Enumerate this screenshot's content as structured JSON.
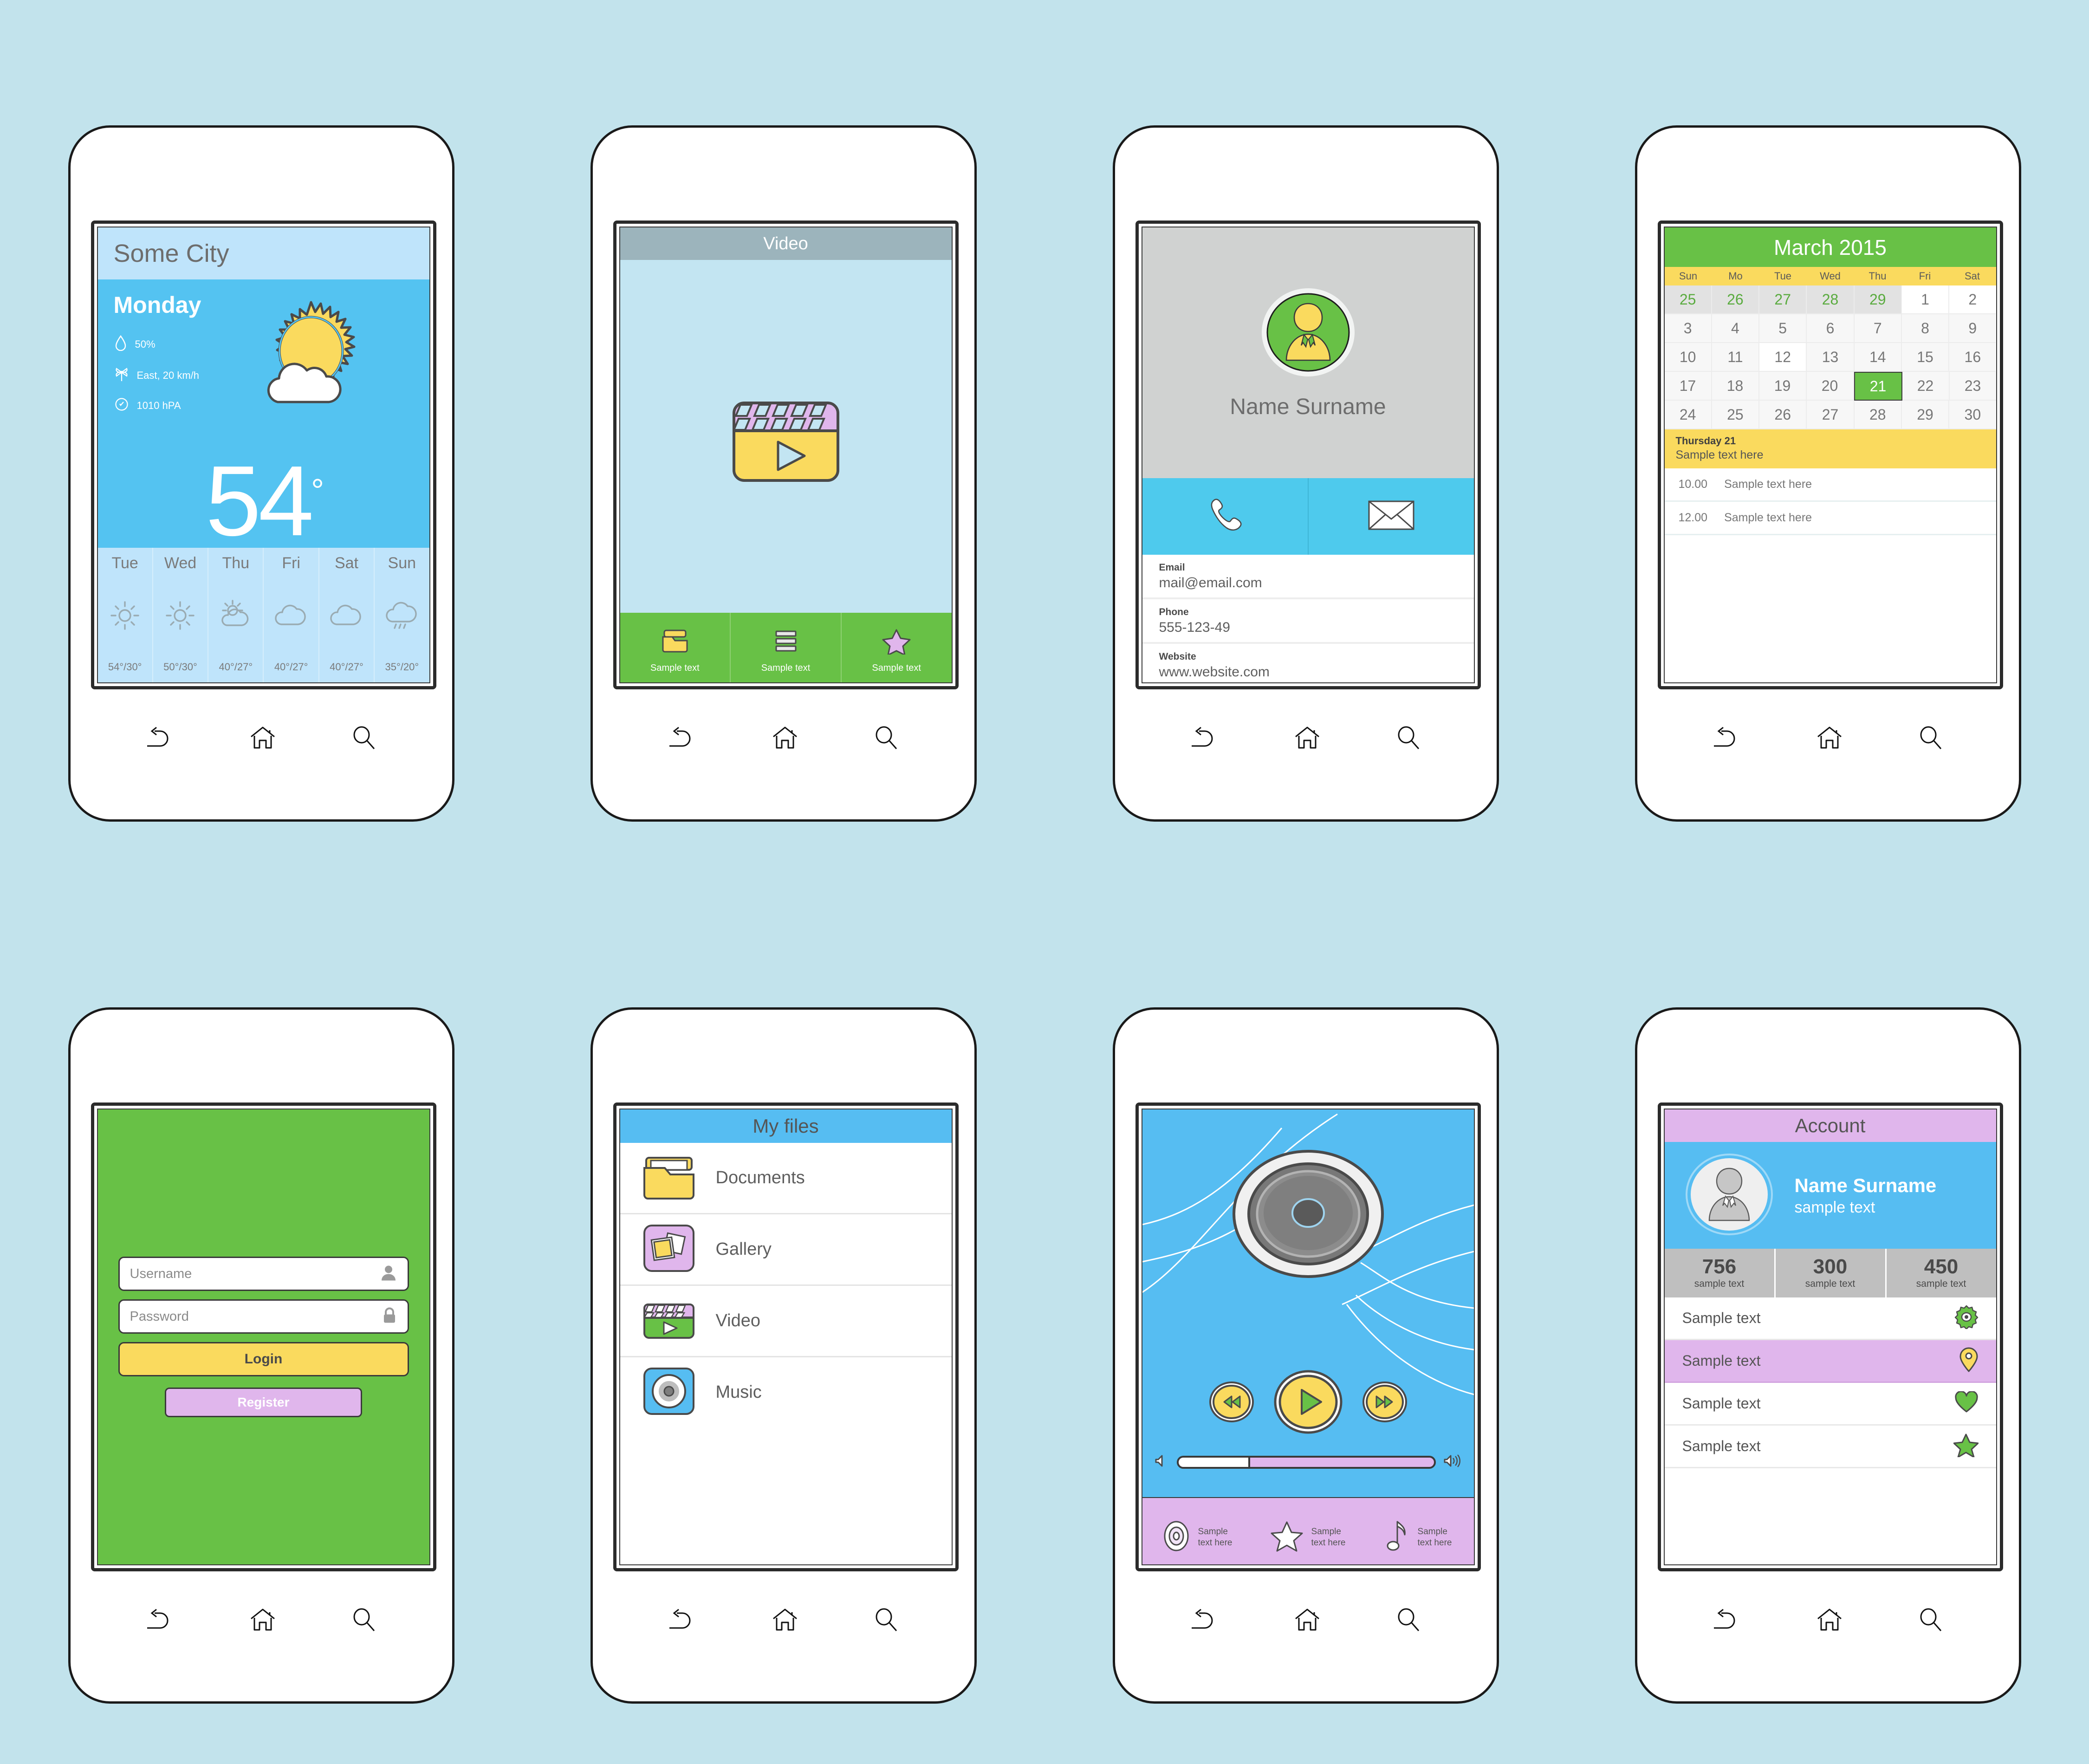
{
  "background_color": "#c2e3ec",
  "nav": {
    "back": "back-icon",
    "home": "home-icon",
    "search": "search-icon"
  },
  "screens": {
    "weather": {
      "city": "Some City",
      "day": "Monday",
      "humidity": "50%",
      "wind": "East, 20 km/h",
      "pressure": "1010 hPA",
      "temperature": "54",
      "degree": "°",
      "forecast": [
        {
          "name": "Tue",
          "icon": "sun-icon",
          "temps": "54°/30°"
        },
        {
          "name": "Wed",
          "icon": "sun-icon",
          "temps": "50°/30°"
        },
        {
          "name": "Thu",
          "icon": "sun-cloud-icon",
          "temps": "40°/27°"
        },
        {
          "name": "Fri",
          "icon": "cloud-icon",
          "temps": "40°/27°"
        },
        {
          "name": "Sat",
          "icon": "cloud-icon",
          "temps": "40°/27°"
        },
        {
          "name": "Sun",
          "icon": "rain-cloud-icon",
          "temps": "35°/20°"
        }
      ]
    },
    "video": {
      "title": "Video",
      "hero_icon": "clapperboard-play-icon",
      "tabs": [
        {
          "icon": "folder-icon",
          "label": "Sample text"
        },
        {
          "icon": "list-icon",
          "label": "Sample text"
        },
        {
          "icon": "star-icon",
          "label": "Sample text"
        }
      ]
    },
    "contact": {
      "avatar_icon": "user-avatar-icon",
      "name": "Name Surname",
      "actions": [
        {
          "icon": "phone-icon",
          "name": "call-action"
        },
        {
          "icon": "envelope-icon",
          "name": "email-action"
        }
      ],
      "fields": [
        {
          "label": "Email",
          "value": "mail@email.com"
        },
        {
          "label": "Phone",
          "value": "555-123-49"
        },
        {
          "label": "Website",
          "value": "www.website.com"
        }
      ]
    },
    "calendar": {
      "month": "March 2015",
      "dows": [
        "Sun",
        "Mo",
        "Tue",
        "Wed",
        "Thu",
        "Fri",
        "Sat"
      ],
      "weeks": [
        [
          {
            "d": "25",
            "t": "prev"
          },
          {
            "d": "26",
            "t": "prev"
          },
          {
            "d": "27",
            "t": "prev"
          },
          {
            "d": "28",
            "t": "prev"
          },
          {
            "d": "29",
            "t": "prev"
          },
          {
            "d": "1",
            "t": "white"
          },
          {
            "d": "2",
            "t": "white"
          }
        ],
        [
          {
            "d": "3",
            "t": ""
          },
          {
            "d": "4",
            "t": ""
          },
          {
            "d": "5",
            "t": ""
          },
          {
            "d": "6",
            "t": ""
          },
          {
            "d": "7",
            "t": ""
          },
          {
            "d": "8",
            "t": ""
          },
          {
            "d": "9",
            "t": ""
          }
        ],
        [
          {
            "d": "10",
            "t": ""
          },
          {
            "d": "11",
            "t": ""
          },
          {
            "d": "12",
            "t": "white"
          },
          {
            "d": "13",
            "t": ""
          },
          {
            "d": "14",
            "t": ""
          },
          {
            "d": "15",
            "t": ""
          },
          {
            "d": "16",
            "t": ""
          }
        ],
        [
          {
            "d": "17",
            "t": ""
          },
          {
            "d": "18",
            "t": ""
          },
          {
            "d": "19",
            "t": ""
          },
          {
            "d": "20",
            "t": ""
          },
          {
            "d": "21",
            "t": "today"
          },
          {
            "d": "22",
            "t": ""
          },
          {
            "d": "23",
            "t": ""
          }
        ],
        [
          {
            "d": "24",
            "t": ""
          },
          {
            "d": "25",
            "t": ""
          },
          {
            "d": "26",
            "t": ""
          },
          {
            "d": "27",
            "t": ""
          },
          {
            "d": "28",
            "t": ""
          },
          {
            "d": "29",
            "t": ""
          },
          {
            "d": "30",
            "t": ""
          }
        ]
      ],
      "event_day": "Thursday 21",
      "event_text": "Sample text here",
      "slots": [
        {
          "time": "10.00",
          "text": "Sample text here"
        },
        {
          "time": "12.00",
          "text": "Sample text here"
        }
      ]
    },
    "login": {
      "username_placeholder": "Username",
      "password_placeholder": "Password",
      "login_label": "Login",
      "register_label": "Register",
      "username_icon": "person-icon",
      "password_icon": "lock-icon"
    },
    "files": {
      "title": "My files",
      "items": [
        {
          "icon": "folder-icon",
          "label": "Documents"
        },
        {
          "icon": "gallery-icon",
          "label": "Gallery"
        },
        {
          "icon": "video-icon",
          "label": "Video"
        },
        {
          "icon": "music-disc-icon",
          "label": "Music"
        }
      ]
    },
    "music": {
      "speaker_icon": "speaker-icon",
      "rewind_icon": "rewind-icon",
      "play_icon": "play-icon",
      "forward_icon": "fast-forward-icon",
      "volume_low_icon": "volume-low-icon",
      "volume_high_icon": "volume-high-icon",
      "progress_percent": 28,
      "tabs": [
        {
          "icon": "disc-icon",
          "label": "Sample\ntext here"
        },
        {
          "icon": "star-icon",
          "label": "Sample\ntext here"
        },
        {
          "icon": "note-icon",
          "label": "Sample\ntext here"
        }
      ]
    },
    "account": {
      "title": "Account",
      "avatar_icon": "user-avatar-icon",
      "name": "Name Surname",
      "subtitle": "sample text",
      "stats": [
        {
          "value": "756",
          "label": "sample text"
        },
        {
          "value": "300",
          "label": "sample text"
        },
        {
          "value": "450",
          "label": "sample text"
        }
      ],
      "rows": [
        {
          "text": "Sample text",
          "icon": "gear-icon",
          "highlight": false
        },
        {
          "text": "Sample text",
          "icon": "location-pin-icon",
          "highlight": true
        },
        {
          "text": "Sample text",
          "icon": "heart-icon",
          "highlight": false
        },
        {
          "text": "Sample text",
          "icon": "star-icon",
          "highlight": false
        }
      ]
    }
  },
  "colors": {
    "green": "#68c146",
    "yellow": "#fada5e",
    "purple": "#e0b6ec",
    "blue": "#56bdf2",
    "sky": "#54c3f1",
    "gray": "#bfbfbf"
  }
}
